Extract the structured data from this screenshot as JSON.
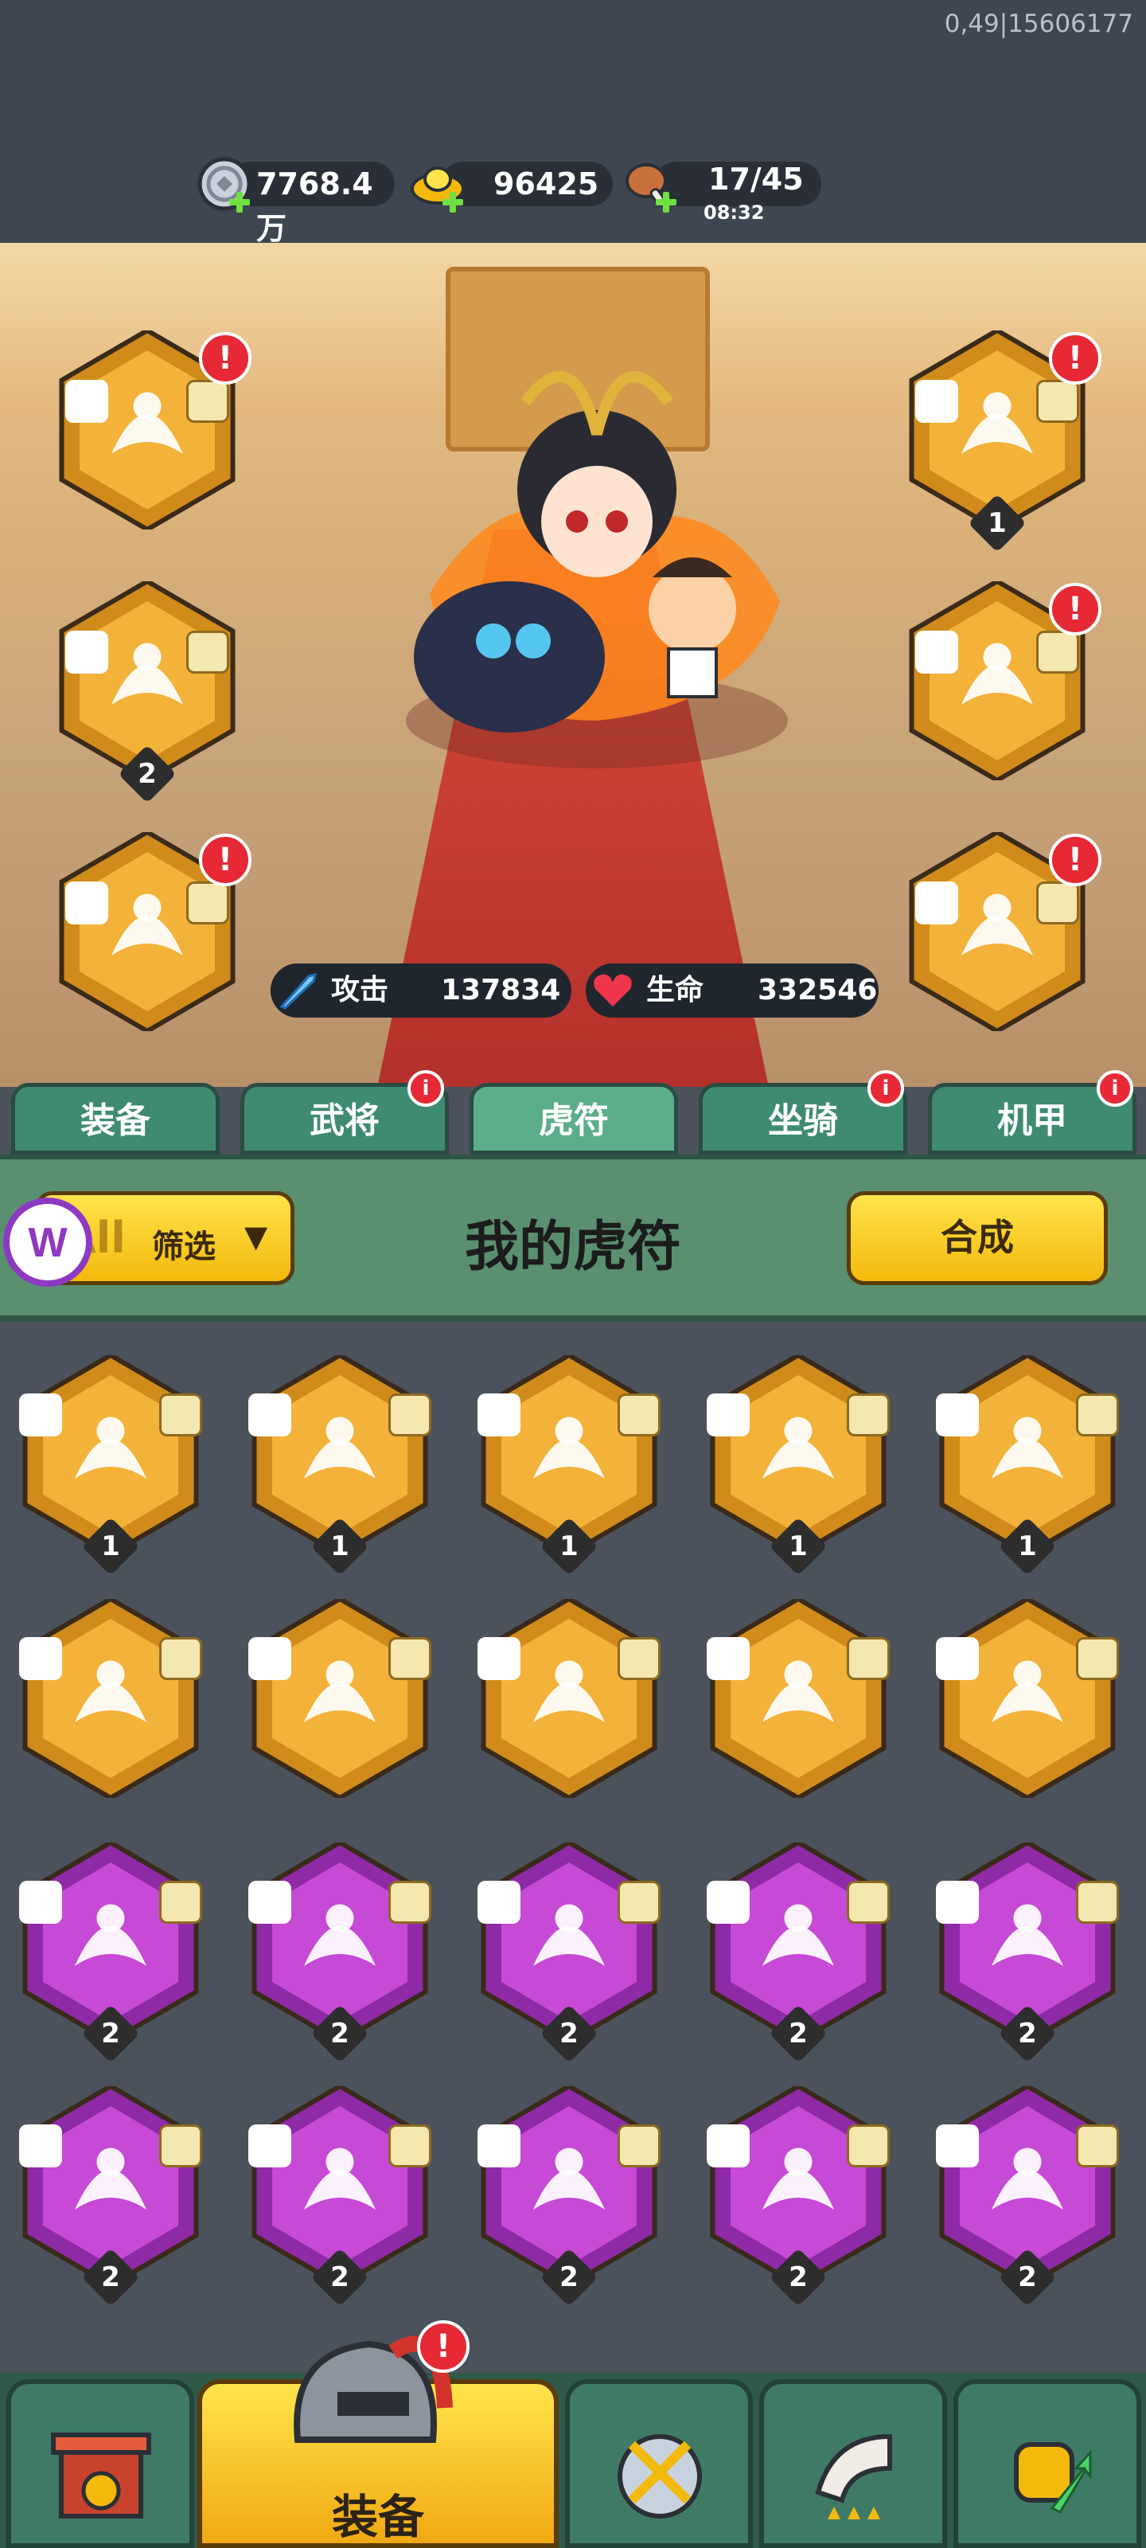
{
  "debug_text": "0,49|15606177",
  "resources": {
    "silver": {
      "icon": "silver-coin-icon",
      "value": "7768.4万"
    },
    "gold": {
      "icon": "gold-ingot-icon",
      "value": "96425"
    },
    "stamina": {
      "icon": "drumstick-icon",
      "value": "17/45",
      "timer": "08:32"
    }
  },
  "stats": {
    "attack": {
      "icon": "sword-icon",
      "label": "攻击",
      "value": "137834"
    },
    "health": {
      "icon": "heart-icon",
      "label": "生命",
      "value": "332546"
    }
  },
  "equipped_slots": {
    "left": [
      {
        "name": "fox-tiger-seal",
        "level": "",
        "alert": true
      },
      {
        "name": "deer-tiger-seal",
        "level": "2",
        "alert": false
      },
      {
        "name": "lion-tiger-seal",
        "level": "",
        "alert": true
      }
    ],
    "right": [
      {
        "name": "ox-tiger-seal",
        "level": "1",
        "alert": true
      },
      {
        "name": "turtle-tiger-seal",
        "level": "",
        "alert": true
      },
      {
        "name": "phoenix-tiger-seal",
        "level": "",
        "alert": true
      }
    ]
  },
  "tabs": [
    {
      "label": "装备",
      "active": false,
      "alert": false
    },
    {
      "label": "武将",
      "active": false,
      "alert": true
    },
    {
      "label": "虎符",
      "active": true,
      "alert": false
    },
    {
      "label": "坐骑",
      "active": false,
      "alert": true
    },
    {
      "label": "机甲",
      "active": false,
      "alert": true
    }
  ],
  "panel": {
    "filter_prefix": "All",
    "filter_label": "筛选",
    "title": "我的虎符",
    "merge_button": "合成"
  },
  "inventory": [
    {
      "rarity": "gold",
      "creature": "tiger",
      "level": "1"
    },
    {
      "rarity": "gold",
      "creature": "eagle",
      "level": "1"
    },
    {
      "rarity": "gold",
      "creature": "dragon",
      "level": "1"
    },
    {
      "rarity": "gold",
      "creature": "ox",
      "level": "1"
    },
    {
      "rarity": "gold",
      "creature": "wolf",
      "level": "1"
    },
    {
      "rarity": "gold",
      "creature": "dragon",
      "level": ""
    },
    {
      "rarity": "gold",
      "creature": "ox",
      "level": ""
    },
    {
      "rarity": "gold",
      "creature": "phoenix",
      "level": ""
    },
    {
      "rarity": "gold",
      "creature": "boar",
      "level": ""
    },
    {
      "rarity": "gold",
      "creature": "snake",
      "level": ""
    },
    {
      "rarity": "purple",
      "creature": "deer",
      "level": "2"
    },
    {
      "rarity": "purple",
      "creature": "dragon",
      "level": "2"
    },
    {
      "rarity": "purple",
      "creature": "tiger",
      "level": "2"
    },
    {
      "rarity": "purple",
      "creature": "fox",
      "level": "2"
    },
    {
      "rarity": "purple",
      "creature": "dragon",
      "level": "2"
    },
    {
      "rarity": "purple",
      "creature": "dragon",
      "level": "2"
    },
    {
      "rarity": "purple",
      "creature": "ox",
      "level": "2"
    },
    {
      "rarity": "purple",
      "creature": "wolf",
      "level": "2"
    },
    {
      "rarity": "purple",
      "creature": "turtle",
      "level": "2"
    },
    {
      "rarity": "purple",
      "creature": "phoenix",
      "level": "2"
    }
  ],
  "bottom_nav": [
    {
      "icon": "castle-gate-icon",
      "label": "",
      "active": false
    },
    {
      "icon": "helmet-icon",
      "label": "装备",
      "active": true,
      "alert": true
    },
    {
      "icon": "sword-shield-icon",
      "label": "",
      "active": false
    },
    {
      "icon": "horn-icon",
      "label": "",
      "active": false
    },
    {
      "icon": "fist-up-icon",
      "label": "",
      "active": false
    }
  ],
  "colors": {
    "gold_tile": "#f3b23a",
    "purple_tile": "#c64ad6",
    "alert": "#e62935",
    "tab_green": "#3f8b72"
  }
}
